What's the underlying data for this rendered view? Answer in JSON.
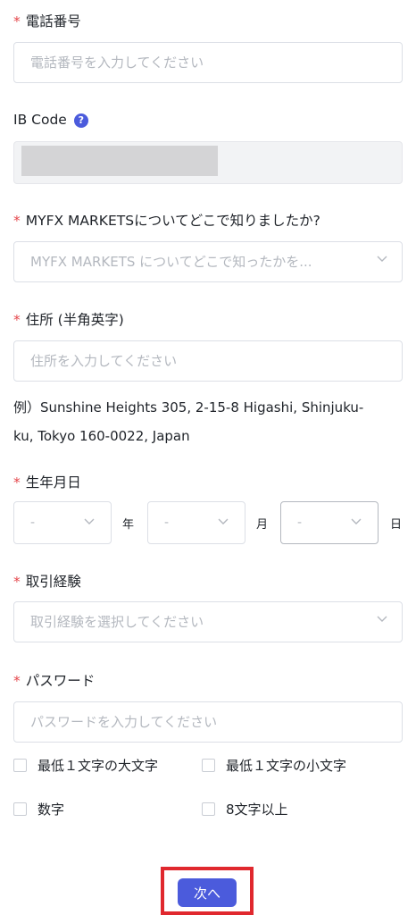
{
  "phone": {
    "label": "電話番号",
    "placeholder": "電話番号を入力してください"
  },
  "ib_code": {
    "label": "IB Code",
    "help_icon": "question-circle-icon"
  },
  "source": {
    "label": "MYFX MARKETSについてどこで知りましたか?",
    "placeholder": "MYFX MARKETS についてどこで知ったかを..."
  },
  "address": {
    "label": "住所 (半角英字)",
    "placeholder": "住所を入力してください",
    "hint_line1": "例）Sunshine Heights 305, 2-15-8 Higashi, Shinjuku-",
    "hint_line2": "ku, Tokyo 160-0022, Japan"
  },
  "birth": {
    "label": "生年月日",
    "year_value": "-",
    "year_unit": "年",
    "month_value": "-",
    "month_unit": "月",
    "day_value": "-",
    "day_unit": "日"
  },
  "experience": {
    "label": "取引経験",
    "placeholder": "取引経験を選択してください"
  },
  "password": {
    "label": "パスワード",
    "placeholder": "パスワードを入力してください",
    "rules": [
      "最低１文字の大文字",
      "最低１文字の小文字",
      "数字",
      "8文字以上"
    ]
  },
  "required_mark": "*",
  "next_button": "次へ",
  "colors": {
    "accent": "#4b5bdc",
    "required": "#e5484d",
    "highlight": "#e0282e"
  }
}
